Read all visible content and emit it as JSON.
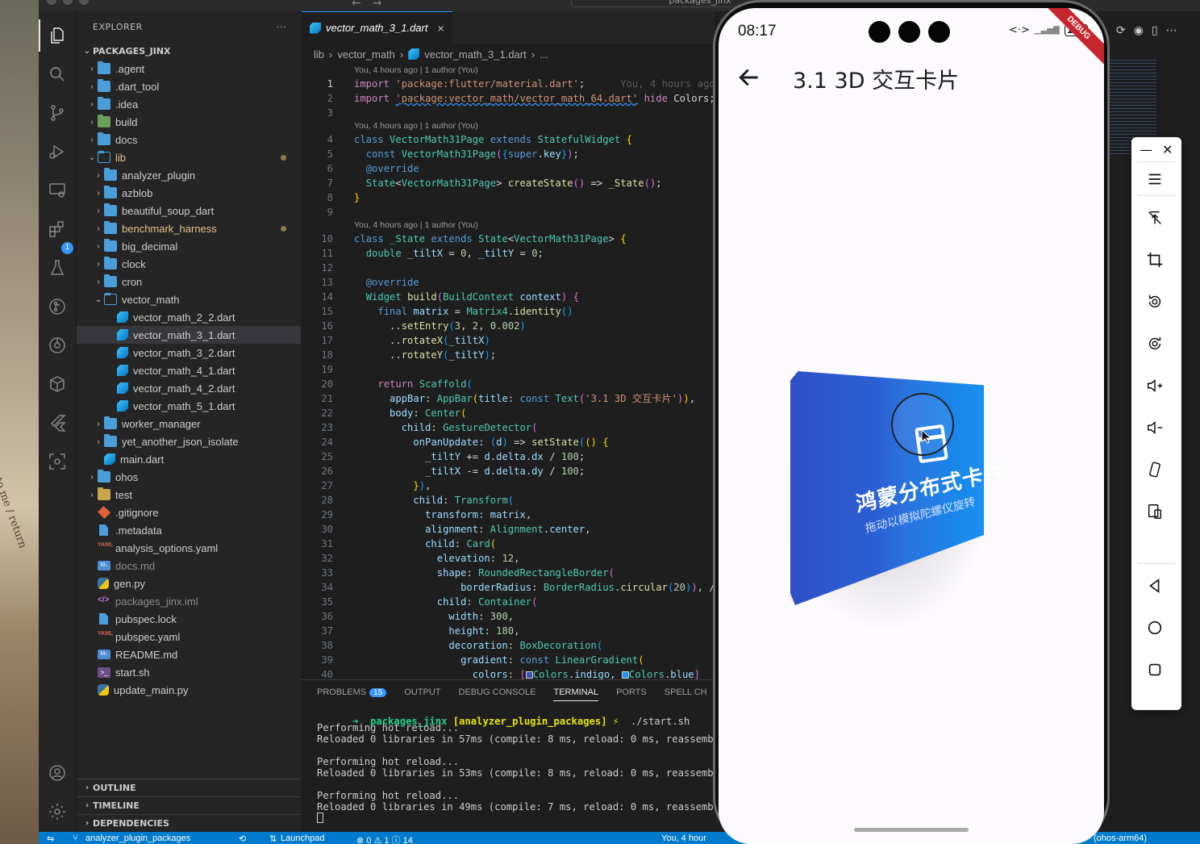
{
  "window": {
    "search_text": "packages_jinx"
  },
  "desktop": {
    "scribble": "to me / return"
  },
  "activity_bar": {
    "extensions_badge": "1",
    "items": [
      "explorer",
      "search",
      "source-control",
      "run-debug",
      "remote-explorer",
      "extensions",
      "testing",
      "git-graph",
      "docker",
      "flutter",
      "accounts",
      "manage"
    ]
  },
  "explorer": {
    "header": "EXPLORER",
    "more": "···",
    "root": "PACKAGES_JINX",
    "tree": [
      {
        "label": ".agent",
        "type": "folder",
        "depth": 0,
        "expanded": false
      },
      {
        "label": ".dart_tool",
        "type": "folder",
        "depth": 0,
        "expanded": false
      },
      {
        "label": ".idea",
        "type": "folder",
        "depth": 0,
        "expanded": false
      },
      {
        "label": "build",
        "type": "folder-build",
        "depth": 0,
        "expanded": false
      },
      {
        "label": "docs",
        "type": "folder",
        "depth": 0,
        "expanded": false
      },
      {
        "label": "lib",
        "type": "folder",
        "depth": 0,
        "expanded": true,
        "modified": true,
        "color": "yellow"
      },
      {
        "label": "analyzer_plugin",
        "type": "folder",
        "depth": 1,
        "expanded": false
      },
      {
        "label": "azblob",
        "type": "folder",
        "depth": 1,
        "expanded": false
      },
      {
        "label": "beautiful_soup_dart",
        "type": "folder",
        "depth": 1,
        "expanded": false
      },
      {
        "label": "benchmark_harness",
        "type": "folder",
        "depth": 1,
        "expanded": false,
        "modified": true,
        "color": "yellow"
      },
      {
        "label": "big_decimal",
        "type": "folder",
        "depth": 1,
        "expanded": false
      },
      {
        "label": "clock",
        "type": "folder",
        "depth": 1,
        "expanded": false
      },
      {
        "label": "cron",
        "type": "folder",
        "depth": 1,
        "expanded": false
      },
      {
        "label": "vector_math",
        "type": "folder",
        "depth": 1,
        "expanded": true
      },
      {
        "label": "vector_math_2_2.dart",
        "type": "dart",
        "depth": 2
      },
      {
        "label": "vector_math_3_1.dart",
        "type": "dart",
        "depth": 2,
        "selected": true
      },
      {
        "label": "vector_math_3_2.dart",
        "type": "dart",
        "depth": 2
      },
      {
        "label": "vector_math_4_1.dart",
        "type": "dart",
        "depth": 2
      },
      {
        "label": "vector_math_4_2.dart",
        "type": "dart",
        "depth": 2
      },
      {
        "label": "vector_math_5_1.dart",
        "type": "dart",
        "depth": 2
      },
      {
        "label": "worker_manager",
        "type": "folder",
        "depth": 1,
        "expanded": false
      },
      {
        "label": "yet_another_json_isolate",
        "type": "folder",
        "depth": 1,
        "expanded": false
      },
      {
        "label": "main.dart",
        "type": "dart",
        "depth": 1
      },
      {
        "label": "ohos",
        "type": "folder",
        "depth": 0,
        "expanded": false
      },
      {
        "label": "test",
        "type": "folder-test",
        "depth": 0,
        "expanded": false
      },
      {
        "label": ".gitignore",
        "type": "git",
        "depth": 0
      },
      {
        "label": ".metadata",
        "type": "file",
        "depth": 0
      },
      {
        "label": "analysis_options.yaml",
        "type": "yaml",
        "depth": 0
      },
      {
        "label": "docs.md",
        "type": "md",
        "depth": 0,
        "color": "gray"
      },
      {
        "label": "gen.py",
        "type": "py",
        "depth": 0
      },
      {
        "label": "packages_jinx.iml",
        "type": "xml",
        "depth": 0,
        "color": "gray"
      },
      {
        "label": "pubspec.lock",
        "type": "file",
        "depth": 0
      },
      {
        "label": "pubspec.yaml",
        "type": "yaml",
        "depth": 0
      },
      {
        "label": "README.md",
        "type": "md",
        "depth": 0
      },
      {
        "label": "start.sh",
        "type": "sh",
        "depth": 0
      },
      {
        "label": "update_main.py",
        "type": "py",
        "depth": 0
      }
    ],
    "sections": [
      "OUTLINE",
      "TIMELINE",
      "DEPENDENCIES"
    ]
  },
  "editor": {
    "tab_label": "vector_math_3_1.dart",
    "tab_close": "×",
    "breadcrumb": [
      "lib",
      "vector_math",
      "vector_math_3_1.dart",
      "..."
    ],
    "lens_text": "You, 4 hours ago | 1 author (You)",
    "inline_blame": "You, 4 hours ago",
    "current_line": 1
  },
  "panel": {
    "tabs": [
      {
        "label": "PROBLEMS",
        "badge": "15"
      },
      {
        "label": "OUTPUT"
      },
      {
        "label": "DEBUG CONSOLE"
      },
      {
        "label": "TERMINAL",
        "active": true
      },
      {
        "label": "PORTS"
      },
      {
        "label": "SPELL CH"
      }
    ],
    "prompt_dir": "packages_jinx",
    "prompt_branch": "[analyzer_plugin_packages]",
    "prompt_symbol": "⚡",
    "prompt_cmd": "./start.sh",
    "output": [
      "Performing hot reload...",
      "Reloaded 0 libraries in 57ms (compile: 8 ms, reload: 0 ms, reassemble:",
      "",
      "Performing hot reload...",
      "Reloaded 0 libraries in 53ms (compile: 8 ms, reload: 0 ms, reassemble:",
      "",
      "Performing hot reload...",
      "Reloaded 0 libraries in 49ms (compile: 7 ms, reload: 0 ms, reassemble:"
    ]
  },
  "statusbar": {
    "branch": "analyzer_plugin_packages",
    "launchpad": "Launchpad",
    "problems": "⊗ 0 ⚠ 1 ⓘ 14",
    "blame": "You, 4 hour",
    "target": "(ohos-arm64)"
  },
  "phone": {
    "time": "08:17",
    "battery": "100",
    "debug_banner": "DEBUG",
    "app_title": "3.1 3D 交互卡片",
    "card_title": "鸿蒙分布式卡片",
    "card_subtitle": "拖动以模拟陀螺仪旋转",
    "colors": {
      "card_start": "#2f50c6",
      "card_end": "#1b8ff0",
      "debug": "#c6262e"
    }
  },
  "emulator_toolbar": {
    "minimize": "—",
    "close": "✕",
    "buttons": [
      "menu",
      "no-touch",
      "crop",
      "rotate-left",
      "rotate-right",
      "volume-up",
      "volume-down",
      "shake",
      "multi-device",
      "back",
      "home",
      "overview"
    ]
  }
}
